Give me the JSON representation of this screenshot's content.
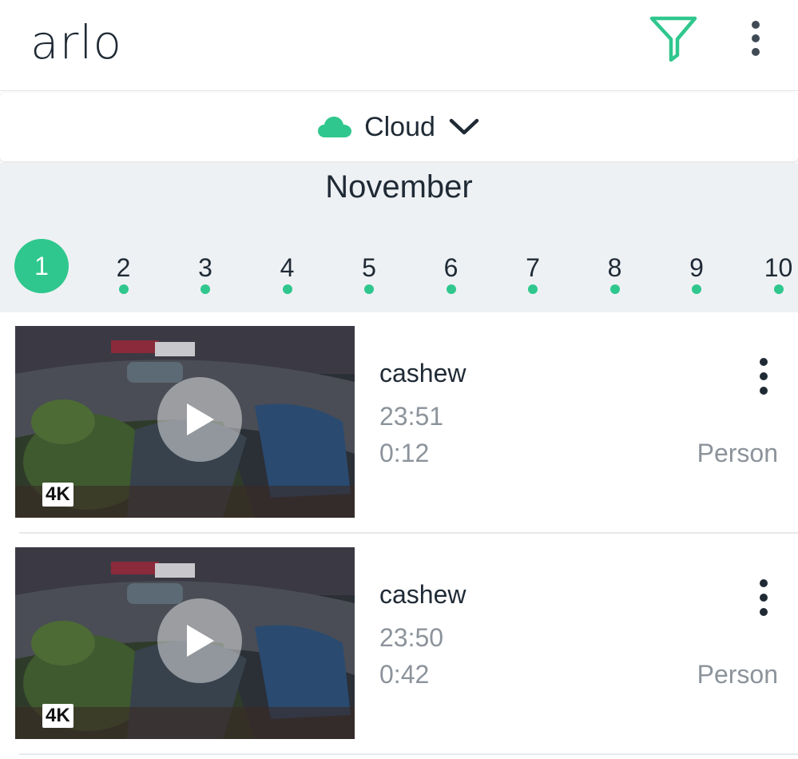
{
  "header": {
    "logo_text": "arlo",
    "filter_icon": "filter-icon",
    "menu_icon": "more-vertical-icon"
  },
  "source": {
    "label": "Cloud",
    "icon": "cloud-icon",
    "dropdown_icon": "chevron-down-icon"
  },
  "calendar": {
    "month": "November",
    "days": [
      "1",
      "2",
      "3",
      "4",
      "5",
      "6",
      "7",
      "8",
      "9",
      "10"
    ],
    "selected_day": "1"
  },
  "recordings": [
    {
      "camera": "cashew",
      "time": "23:51",
      "duration": "0:12",
      "tag": "Person",
      "quality_badge": "4K"
    },
    {
      "camera": "cashew",
      "time": "23:50",
      "duration": "0:42",
      "tag": "Person",
      "quality_badge": "4K"
    }
  ],
  "colors": {
    "accent": "#2fc78d",
    "text_primary": "#1f2a35",
    "text_secondary": "#8c939b",
    "calendar_bg": "#eef1f4"
  }
}
